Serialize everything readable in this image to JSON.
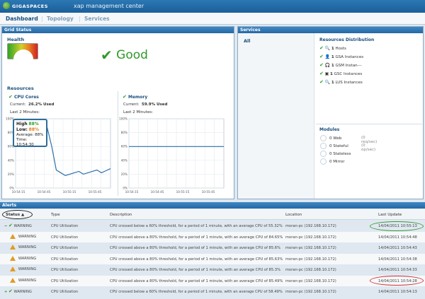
{
  "window": {
    "brand": "GIGASPACES",
    "title": "xap management center"
  },
  "tabs": [
    {
      "label": "Dashboard"
    },
    {
      "label": "Topology"
    },
    {
      "label": "Services"
    }
  ],
  "grid_status": {
    "header": "Grid Status",
    "health_label": "Health",
    "status": "Good",
    "resources_label": "Resources"
  },
  "cpu": {
    "title": "CPU Cores",
    "current_label": "Current:",
    "current_value": "26.2% Used",
    "period": "Last 2 Minutes:",
    "yticks": [
      "100%",
      "80%",
      "60%",
      "40%",
      "20%",
      "0%"
    ],
    "xticks": [
      "10:54:15",
      "10:54:45",
      "10:55:15",
      "10:55:45"
    ],
    "tooltip": {
      "high_label": "High",
      "high": "88%",
      "low_label": "Low:",
      "low": "88%",
      "avg": "Average: 88%",
      "time": "Time: 10:54:30"
    }
  },
  "memory": {
    "title": "Memory",
    "current_label": "Current:",
    "current_value": "59.9% Used",
    "period": "Last 2 Minutes:",
    "yticks": [
      "100%",
      "80%",
      "60%",
      "40%",
      "20%",
      "0%"
    ],
    "xticks": [
      "10:54:15",
      "10:54:45",
      "10:55:15",
      "10:55:45"
    ]
  },
  "services": {
    "header": "Services",
    "all": "All",
    "distribution_title": "Resources Distribution",
    "items": [
      {
        "count": "1",
        "label": "Hosts"
      },
      {
        "count": "1",
        "label": "GSA Instances"
      },
      {
        "count": "1",
        "label": "GSM Instan---"
      },
      {
        "count": "1",
        "label": "GSC Instances"
      },
      {
        "count": "1",
        "label": "LUS Instances"
      }
    ],
    "modules_title": "Modules",
    "modules": [
      {
        "count": "0",
        "label": "Web",
        "rate": "(0 req/sec)"
      },
      {
        "count": "0",
        "label": "Stateful",
        "rate": "(0 op/sec)"
      },
      {
        "count": "0",
        "label": "Stateless",
        "rate": ""
      },
      {
        "count": "0",
        "label": "Mirror",
        "rate": ""
      }
    ]
  },
  "alerts": {
    "header": "Alerts",
    "columns": [
      "Status",
      "Type",
      "Description",
      "Location",
      "Last Update"
    ],
    "rows": [
      {
        "status": "WARNING",
        "type": "CPU Utilization",
        "desc": "CPU crossed below a 60% threshold, for a period of 1 minute, with an average CPU of 55.32%",
        "loc": "moran-pc (192.168.10.172)",
        "time": "14/04/2011 10:55:13"
      },
      {
        "status": "WARNING",
        "type": "CPU Utilization",
        "desc": "CPU crossed above a 80% threshold, for a period of 1 minute, with an average CPU of 84.65%",
        "loc": "moran-pc (192.168.10.172)",
        "time": "14/04/2011 10:54:48"
      },
      {
        "status": "WARNING",
        "type": "CPU Utilization",
        "desc": "CPU crossed above a 80% threshold, for a period of 1 minute, with an average CPU of 85.6%",
        "loc": "moran-pc (192.168.10.172)",
        "time": "14/04/2011 10:54:43"
      },
      {
        "status": "WARNING",
        "type": "CPU Utilization",
        "desc": "CPU crossed above a 80% threshold, for a period of 1 minute, with an average CPU of 85.63%",
        "loc": "moran-pc (192.168.10.172)",
        "time": "14/04/2011 10:54:38"
      },
      {
        "status": "WARNING",
        "type": "CPU Utilization",
        "desc": "CPU crossed above a 80% threshold, for a period of 1 minute, with an average CPU of 85.3%",
        "loc": "moran-pc (192.168.10.172)",
        "time": "14/04/2011 10:54:33"
      },
      {
        "status": "WARNING",
        "type": "CPU Utilization",
        "desc": "CPU crossed above a 80% threshold, for a period of 1 minute, with an average CPU of 85.49%",
        "loc": "moran-pc (192.168.10.172)",
        "time": "14/04/2011 10:54:28"
      },
      {
        "status": "WARNING",
        "type": "CPU Utilization",
        "desc": "CPU crossed below a 60% threshold, for a period of 1 minute, with an average CPU of 58.49%",
        "loc": "moran-pc (192.168.10.172)",
        "time": "14/04/2011 10:54:13"
      }
    ]
  },
  "chart_data": [
    {
      "type": "line",
      "title": "CPU Cores",
      "x": [
        "10:54:15",
        "10:54:45",
        "10:55:15",
        "10:55:45"
      ],
      "ylim": [
        0,
        100
      ],
      "series": [
        {
          "values": [
            88,
            88,
            87,
            88,
            88,
            86,
            88,
            87,
            60,
            26,
            22,
            18,
            20,
            22,
            24,
            20,
            22,
            24,
            26,
            22,
            25,
            28
          ]
        }
      ]
    },
    {
      "type": "line",
      "title": "Memory",
      "x": [
        "10:54:15",
        "10:54:45",
        "10:55:15",
        "10:55:45"
      ],
      "ylim": [
        0,
        100
      ],
      "series": [
        {
          "values": [
            59.9,
            59.9,
            59.9,
            59.9,
            59.9,
            59.9,
            59.9,
            59.9,
            59.9,
            59.9
          ]
        }
      ]
    }
  ]
}
